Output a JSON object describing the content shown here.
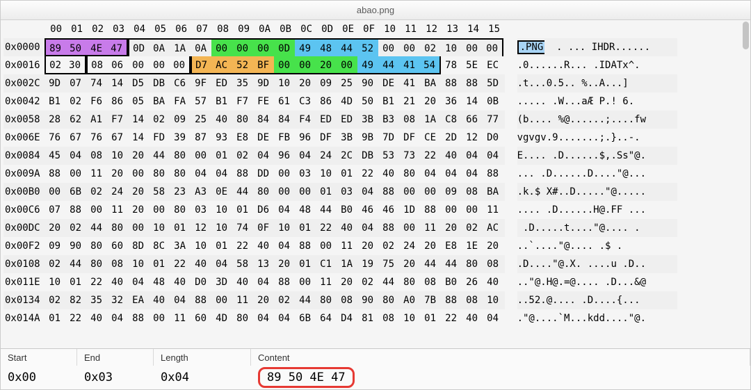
{
  "title": "abao.png",
  "col_headers": [
    "00",
    "01",
    "02",
    "03",
    "04",
    "05",
    "06",
    "07",
    "08",
    "09",
    "0A",
    "0B",
    "0C",
    "0D",
    "0E",
    "0F",
    "10",
    "11",
    "12",
    "13",
    "14",
    "15"
  ],
  "rows": [
    {
      "addr": "0x0000",
      "bytes": [
        "89",
        "50",
        "4E",
        "47",
        "0D",
        "0A",
        "1A",
        "0A",
        "00",
        "00",
        "00",
        "0D",
        "49",
        "48",
        "44",
        "52",
        "00",
        "00",
        "02",
        "10",
        "00",
        "00"
      ],
      "ascii": ".PNG  . ... IHDR......",
      "hl": [
        "p",
        "p",
        "p",
        "p",
        "",
        "",
        "",
        "",
        "g",
        "g",
        "g",
        "g",
        "c",
        "c",
        "c",
        "c",
        "",
        "",
        "",
        "",
        "",
        ""
      ],
      "seg": [
        1,
        1,
        1,
        1,
        2,
        2,
        2,
        2,
        2,
        2,
        2,
        2,
        2,
        2,
        2,
        2,
        2,
        2,
        2,
        2,
        2,
        2
      ]
    },
    {
      "addr": "0x0016",
      "bytes": [
        "02",
        "30",
        "08",
        "06",
        "00",
        "00",
        "00",
        "D7",
        "AC",
        "52",
        "BF",
        "00",
        "00",
        "20",
        "00",
        "49",
        "44",
        "41",
        "54",
        "78",
        "5E",
        "EC"
      ],
      "ascii": ".0......R... .IDATx^.",
      "hl": [
        "",
        "",
        "",
        "",
        "",
        "",
        "",
        "o",
        "o",
        "o",
        "o",
        "g",
        "g",
        "g",
        "g",
        "c",
        "c",
        "c",
        "c",
        "",
        "",
        ""
      ],
      "seg": [
        2,
        2,
        3,
        3,
        3,
        3,
        3,
        2,
        2,
        2,
        2,
        2,
        2,
        2,
        2,
        2,
        2,
        2,
        2,
        0,
        0,
        0
      ]
    },
    {
      "addr": "0x002C",
      "bytes": [
        "9D",
        "07",
        "74",
        "14",
        "D5",
        "DB",
        "C6",
        "9F",
        "ED",
        "35",
        "9D",
        "10",
        "20",
        "09",
        "25",
        "90",
        "DE",
        "41",
        "BA",
        "88",
        "88",
        "5D"
      ],
      "ascii": ".t...0.5.. %..A...]"
    },
    {
      "addr": "0x0042",
      "bytes": [
        "B1",
        "02",
        "F6",
        "86",
        "05",
        "BA",
        "FA",
        "57",
        "B1",
        "F7",
        "FE",
        "61",
        "C3",
        "86",
        "4D",
        "50",
        "B1",
        "21",
        "20",
        "36",
        "14",
        "0B"
      ],
      "ascii": "..... .W...aÆ P.! 6."
    },
    {
      "addr": "0x0058",
      "bytes": [
        "28",
        "62",
        "A1",
        "F7",
        "14",
        "02",
        "09",
        "25",
        "40",
        "80",
        "84",
        "84",
        "F4",
        "ED",
        "ED",
        "3B",
        "B3",
        "08",
        "1A",
        "C8",
        "66",
        "77"
      ],
      "ascii": "(b.... %@......;....fw"
    },
    {
      "addr": "0x006E",
      "bytes": [
        "76",
        "67",
        "76",
        "67",
        "14",
        "FD",
        "39",
        "87",
        "93",
        "E8",
        "DE",
        "FB",
        "96",
        "DF",
        "3B",
        "9B",
        "7D",
        "DF",
        "CE",
        "2D",
        "12",
        "D0"
      ],
      "ascii": "vgvgv.9.......;.}..-."
    },
    {
      "addr": "0x0084",
      "bytes": [
        "45",
        "04",
        "08",
        "10",
        "20",
        "44",
        "80",
        "00",
        "01",
        "02",
        "04",
        "96",
        "04",
        "24",
        "2C",
        "DB",
        "53",
        "73",
        "22",
        "40",
        "04",
        "04"
      ],
      "ascii": "E.... .D......$,.Ss\"@."
    },
    {
      "addr": "0x009A",
      "bytes": [
        "88",
        "00",
        "11",
        "20",
        "00",
        "80",
        "80",
        "04",
        "04",
        "88",
        "DD",
        "00",
        "03",
        "10",
        "01",
        "22",
        "40",
        "80",
        "04",
        "04",
        "04",
        "88"
      ],
      "ascii": "... .D......D....\"@..."
    },
    {
      "addr": "0x00B0",
      "bytes": [
        "00",
        "6B",
        "02",
        "24",
        "20",
        "58",
        "23",
        "A3",
        "0E",
        "44",
        "80",
        "00",
        "00",
        "01",
        "03",
        "04",
        "88",
        "00",
        "00",
        "09",
        "08",
        "BA"
      ],
      "ascii": ".k.$ X#..D.....\"@....."
    },
    {
      "addr": "0x00C6",
      "bytes": [
        "07",
        "88",
        "00",
        "11",
        "20",
        "00",
        "80",
        "03",
        "10",
        "01",
        "D6",
        "04",
        "48",
        "44",
        "B0",
        "46",
        "46",
        "1D",
        "88",
        "00",
        "00",
        "11"
      ],
      "ascii": ".... .D......H@.FF ..."
    },
    {
      "addr": "0x00DC",
      "bytes": [
        "20",
        "02",
        "44",
        "80",
        "00",
        "10",
        "01",
        "12",
        "10",
        "74",
        "0F",
        "10",
        "01",
        "22",
        "40",
        "04",
        "88",
        "00",
        "11",
        "20",
        "02",
        "AC"
      ],
      "ascii": " .D.....t....\"@.... ."
    },
    {
      "addr": "0x00F2",
      "bytes": [
        "09",
        "90",
        "80",
        "60",
        "8D",
        "8C",
        "3A",
        "10",
        "01",
        "22",
        "40",
        "04",
        "88",
        "00",
        "11",
        "20",
        "02",
        "24",
        "20",
        "E8",
        "1E",
        "20"
      ],
      "ascii": "..`....\"@.... .$ ."
    },
    {
      "addr": "0x0108",
      "bytes": [
        "02",
        "44",
        "80",
        "08",
        "10",
        "01",
        "22",
        "40",
        "04",
        "58",
        "13",
        "20",
        "01",
        "C1",
        "1A",
        "19",
        "75",
        "20",
        "44",
        "44",
        "80",
        "08"
      ],
      "ascii": ".D....\"@.X. ....u .D.."
    },
    {
      "addr": "0x011E",
      "bytes": [
        "10",
        "01",
        "22",
        "40",
        "04",
        "48",
        "40",
        "D0",
        "3D",
        "40",
        "04",
        "88",
        "00",
        "11",
        "20",
        "02",
        "44",
        "80",
        "08",
        "B0",
        "26",
        "40"
      ],
      "ascii": "..\"@.H@.=@.... .D...&@"
    },
    {
      "addr": "0x0134",
      "bytes": [
        "02",
        "82",
        "35",
        "32",
        "EA",
        "40",
        "04",
        "88",
        "00",
        "11",
        "20",
        "02",
        "44",
        "80",
        "08",
        "90",
        "80",
        "A0",
        "7B",
        "88",
        "08",
        "10"
      ],
      "ascii": "..52.@.... .D....{..."
    },
    {
      "addr": "0x014A",
      "bytes": [
        "01",
        "22",
        "40",
        "04",
        "88",
        "00",
        "11",
        "60",
        "4D",
        "80",
        "04",
        "04",
        "6B",
        "64",
        "D4",
        "81",
        "08",
        "10",
        "01",
        "22",
        "40",
        "04"
      ],
      "ascii": ".\"@....`M...kdd....\"@."
    }
  ],
  "footer": {
    "headers": {
      "start": "Start",
      "end": "End",
      "length": "Length",
      "content": "Content"
    },
    "values": {
      "start": "0x00",
      "end": "0x03",
      "length": "0x04",
      "content": "89 50 4E 47"
    }
  }
}
